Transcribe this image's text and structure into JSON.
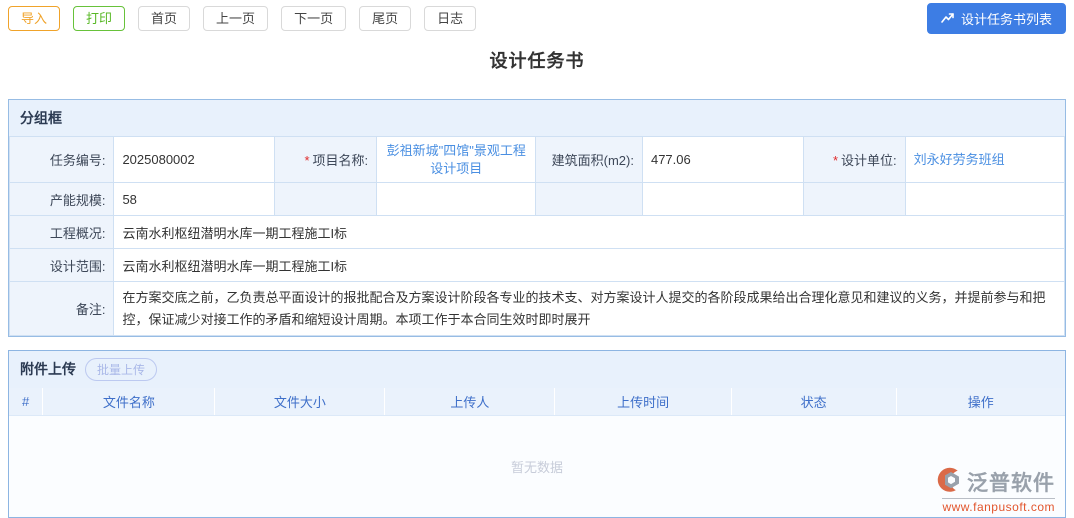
{
  "toolbar": {
    "import_label": "导入",
    "print_label": "打印",
    "home_label": "首页",
    "prev_label": "上一页",
    "next_label": "下一页",
    "last_label": "尾页",
    "log_label": "日志",
    "list_button_label": "设计任务书列表"
  },
  "page_title": "设计任务书",
  "group_box": {
    "title": "分组框",
    "required_mark": "*",
    "fields": {
      "task_no": {
        "label": "任务编号:",
        "value": "2025080002"
      },
      "project_name": {
        "label": "项目名称:",
        "value": "彭祖新城\"四馆\"景观工程设计项目"
      },
      "building_area": {
        "label": "建筑面积(m2):",
        "value": "477.06"
      },
      "design_unit": {
        "label": "设计单位:",
        "value": "刘永好劳务班组"
      },
      "capacity": {
        "label": "产能规模:",
        "value": "58"
      },
      "overview": {
        "label": "工程概况:",
        "value": "云南水利枢纽潜明水库一期工程施工I标"
      },
      "scope": {
        "label": "设计范围:",
        "value": "云南水利枢纽潜明水库一期工程施工I标"
      },
      "remark": {
        "label": "备注:",
        "value": "在方案交底之前，乙负责总平面设计的报批配合及方案设计阶段各专业的技术支、对方案设计人提交的各阶段成果给出合理化意见和建议的义务，并提前参与和把控，保证减少对接工作的矛盾和缩短设计周期。本项工作于本合同生效时即时展开"
      }
    }
  },
  "attachments": {
    "title": "附件上传",
    "batch_upload_label": "批量上传",
    "columns": [
      "#",
      "文件名称",
      "文件大小",
      "上传人",
      "上传时间",
      "状态",
      "操作"
    ],
    "rows": [],
    "empty_text": "暂无数据"
  },
  "footer": {
    "brand": "泛普软件",
    "website": "www.fanpusoft.com"
  },
  "colors": {
    "accent_blue": "#3d7de4",
    "link_blue": "#4a8fe2",
    "import_orange": "#f0a32a",
    "print_green": "#58b825",
    "header_bg": "#e8f1fc",
    "label_bg": "#eef4fc",
    "table_border": "#cfe0f3",
    "required_red": "#e02b2b",
    "brand_orange": "#e2562e"
  }
}
